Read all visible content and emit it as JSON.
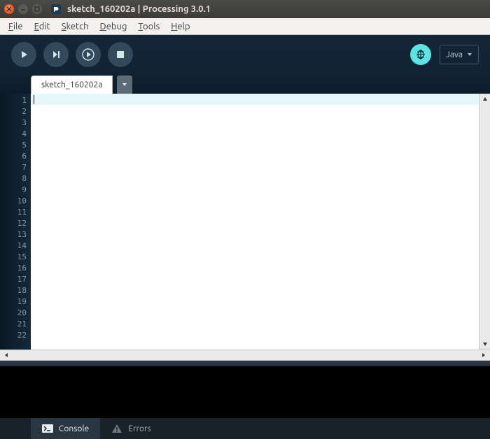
{
  "title": "sketch_160202a | Processing 3.0.1",
  "menu": {
    "file": "File",
    "edit": "Edit",
    "sketch": "Sketch",
    "debug": "Debug",
    "tools": "Tools",
    "help": "Help"
  },
  "mode": {
    "label": "Java"
  },
  "tabs": {
    "active": "sketch_160202a"
  },
  "gutter_lines": 22,
  "bottom": {
    "console": "Console",
    "errors": "Errors"
  }
}
